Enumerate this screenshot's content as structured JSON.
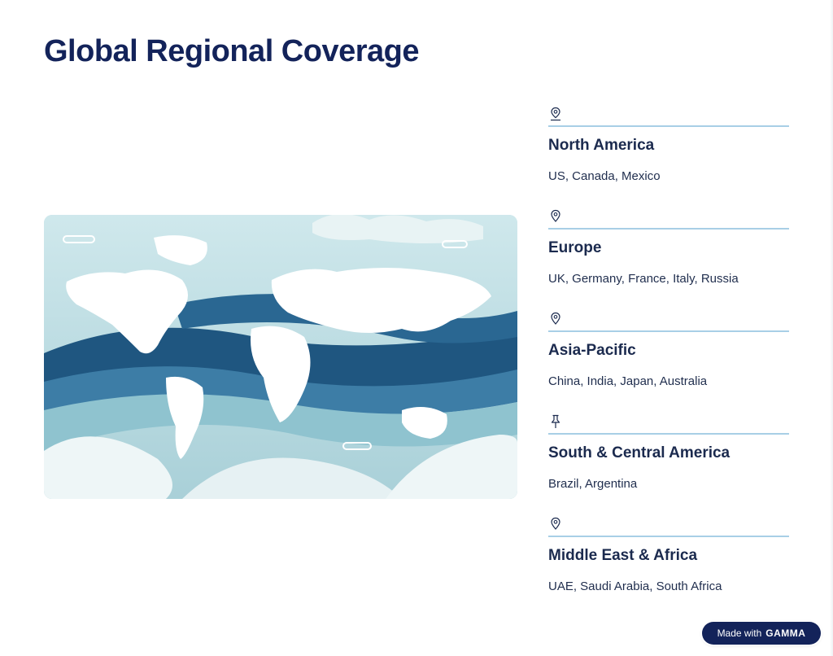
{
  "title": "Global Regional Coverage",
  "regions": [
    {
      "icon": "location-icon",
      "name": "North America",
      "countries": "US, Canada, Mexico"
    },
    {
      "icon": "map-pin-icon",
      "name": "Europe",
      "countries": "UK, Germany, France, Italy, Russia"
    },
    {
      "icon": "map-pin-icon",
      "name": "Asia-Pacific",
      "countries": "China, India, Japan, Australia"
    },
    {
      "icon": "pushpin-icon",
      "name": "South & Central America",
      "countries": "Brazil, Argentina"
    },
    {
      "icon": "map-pin-icon",
      "name": "Middle East & Africa",
      "countries": "UAE, Saudi Arabia, South Africa"
    }
  ],
  "badge": {
    "prefix": "Made with",
    "brand": "GAMMA"
  },
  "colors": {
    "title": "#13235a",
    "accent_rule": "#a8cfe6",
    "map_background": "#bcdde3",
    "map_dark_wave": "#1f5680",
    "badge": "#13235a"
  }
}
